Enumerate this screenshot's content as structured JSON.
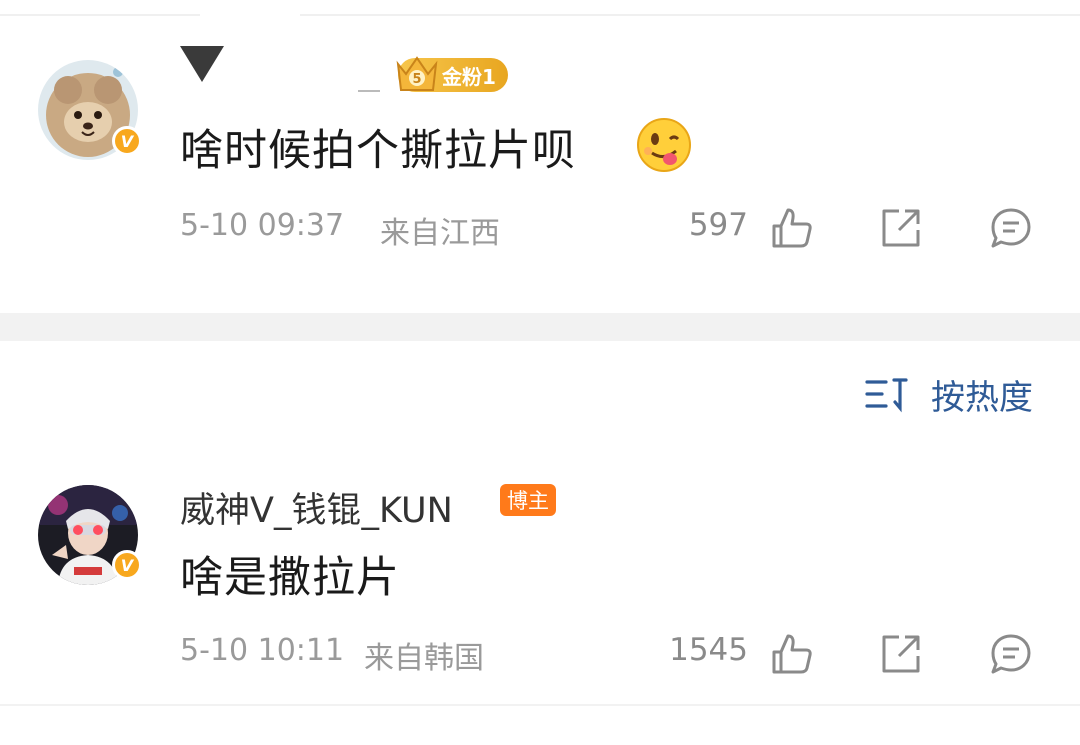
{
  "comments": [
    {
      "username": "",
      "fan_badge": "金粉1",
      "text": "啥时候拍个撕拉片呗",
      "emoji": "tongue-out-emoji",
      "time": "5-10 09:37",
      "location": "来自江西",
      "likes": "597"
    },
    {
      "username": "威神V_钱锟_KUN",
      "role_badge": "博主",
      "text": "啥是撒拉片",
      "time": "5-10 10:11",
      "location": "来自韩国",
      "likes": "1545"
    }
  ],
  "sort": {
    "label": "按热度",
    "icon": "sort-icon"
  },
  "colors": {
    "accent": "#2f5b97",
    "verified": "#f8a81e",
    "host_badge": "#ff7a1a",
    "fan_badge": "#e8a620"
  }
}
